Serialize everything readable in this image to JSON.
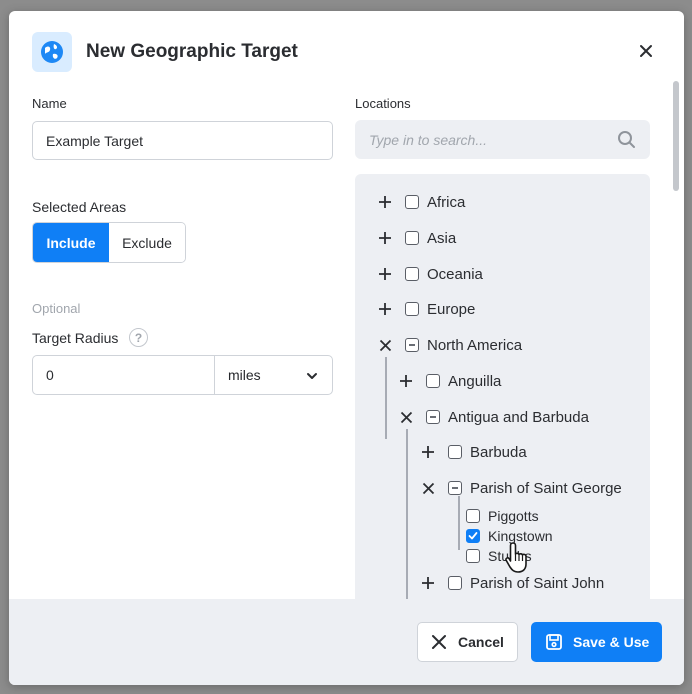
{
  "dialog": {
    "title": "New Geographic Target",
    "icon": "globe-icon"
  },
  "form": {
    "name_label": "Name",
    "name_value": "Example Target",
    "selected_areas_label": "Selected Areas",
    "include_label": "Include",
    "exclude_label": "Exclude",
    "optional_label": "Optional",
    "radius_label": "Target Radius",
    "help_glyph": "?",
    "radius_value": "0",
    "unit_selected": "miles"
  },
  "locations": {
    "label": "Locations",
    "search_placeholder": "Type in to search...",
    "tree": [
      {
        "label": "Africa",
        "state": "collapsed",
        "checked": "unchecked"
      },
      {
        "label": "Asia",
        "state": "collapsed",
        "checked": "unchecked"
      },
      {
        "label": "Oceania",
        "state": "collapsed",
        "checked": "unchecked"
      },
      {
        "label": "Europe",
        "state": "collapsed",
        "checked": "unchecked"
      },
      {
        "label": "North America",
        "state": "expanded",
        "checked": "partial"
      },
      {
        "label": "Anguilla",
        "state": "collapsed",
        "checked": "unchecked"
      },
      {
        "label": "Antigua and Barbuda",
        "state": "expanded",
        "checked": "partial"
      },
      {
        "label": "Barbuda",
        "state": "collapsed",
        "checked": "unchecked"
      },
      {
        "label": "Parish of Saint George",
        "state": "expanded",
        "checked": "partial"
      },
      {
        "label": "Piggotts",
        "state": "leaf",
        "checked": "unchecked"
      },
      {
        "label": "Kingstown",
        "state": "leaf",
        "checked": "checked"
      },
      {
        "label": "Stubbs",
        "state": "leaf",
        "checked": "unchecked"
      },
      {
        "label": "Parish of Saint John",
        "state": "collapsed",
        "checked": "unchecked"
      }
    ]
  },
  "footer": {
    "cancel_label": "Cancel",
    "save_label": "Save & Use"
  },
  "colors": {
    "accent": "#0f7ff6",
    "panel": "#edeff3",
    "text": "#2b2d31",
    "muted": "#a1a6ad"
  }
}
